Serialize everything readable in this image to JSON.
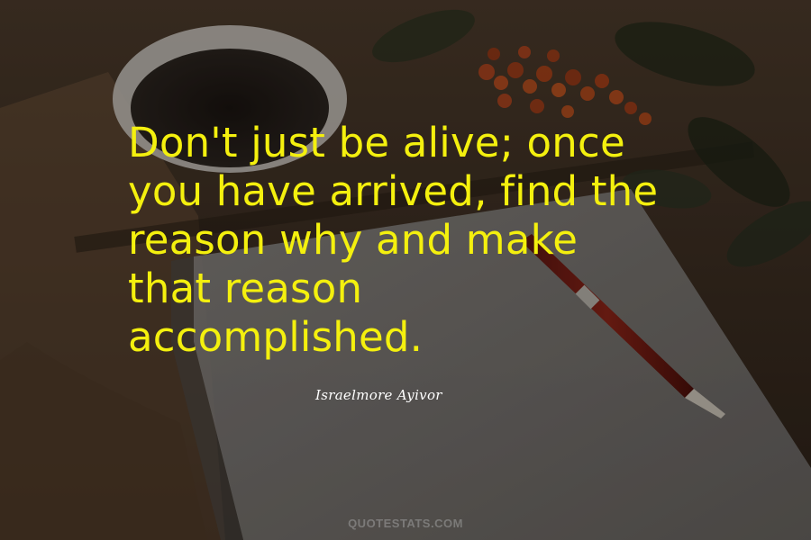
{
  "quote": {
    "text": "Don't just be alive; once\nyou have arrived, find the\nreason why and make\nthat reason\naccomplished."
  },
  "author": {
    "name": "Israelmore Ayivor"
  },
  "watermark": {
    "text": "QUOTESTATS.COM"
  },
  "colors": {
    "quote_text": "#f4f00e",
    "author_text": "#ffffff",
    "watermark_text": "#a0a0a0"
  }
}
